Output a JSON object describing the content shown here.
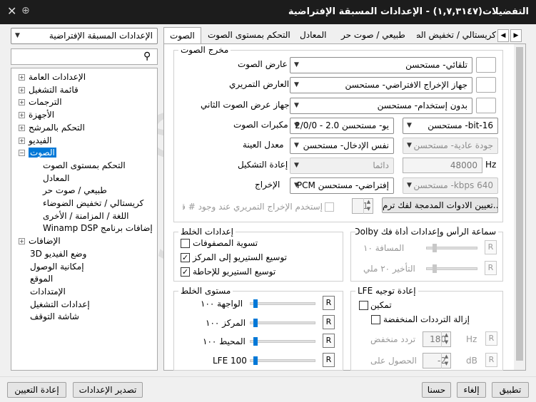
{
  "window": {
    "title": "التفضيلات(١,٧,٣١٤٧) - الإعدادات المسبقة الإفتراضية"
  },
  "preset": {
    "value": "الإعدادات المسبقة الإفتراضية"
  },
  "search": {
    "placeholder": ""
  },
  "tree": [
    {
      "label": "الإعدادات العامة",
      "expander": "+"
    },
    {
      "label": "قائمة التشغيل",
      "expander": "+"
    },
    {
      "label": "الترجمات",
      "expander": "+"
    },
    {
      "label": "الأجهزة",
      "expander": "+"
    },
    {
      "label": "التحكم بالمرشح",
      "expander": "+"
    },
    {
      "label": "الفيديو",
      "expander": "+"
    },
    {
      "label": "الصوت",
      "expander": "−"
    },
    {
      "label": "التحكم بمستوى الصوت"
    },
    {
      "label": "المعادل"
    },
    {
      "label": "طبيعي / صوت حر"
    },
    {
      "label": "كريستالي / تخفيض الضوضاء"
    },
    {
      "label": "اللغة / المزامنة / الأخرى"
    },
    {
      "label": "إضافات برنامج Winamp DSP"
    },
    {
      "label": "الإضافات",
      "expander": "+"
    },
    {
      "label": "وضع الفيديو 3D"
    },
    {
      "label": "إمكانية الوصول"
    },
    {
      "label": "الموقع"
    },
    {
      "label": "الإمتدادات"
    },
    {
      "label": "إعدادات التشغيل"
    },
    {
      "label": "شاشة التوقف"
    }
  ],
  "tabs": [
    {
      "label": "الصوت"
    },
    {
      "label": "التحكم بمستوى الصوت"
    },
    {
      "label": "المعادل"
    },
    {
      "label": "طبيعي / صوت حر"
    },
    {
      "label": "كريستالي / تخفيض الضوضاء"
    }
  ],
  "audio_output": {
    "group_label": "مخرج الصوت",
    "renderer_label": "عارض الصوت",
    "renderer_value": "تلقائي- مستحسن",
    "preview_label": "العارض التمريري",
    "preview_value": "جهاز الإخراج الافتراضي- مستحسن",
    "secondary_label": "جهاز عرض الصوت الثاني",
    "secondary_value": "بدون إستخدام- مستحسن",
    "speakers_label": "مكبرات الصوت",
    "speakers_value": "يو- مستحسن 2.0 - 2/0/0",
    "bitdepth_value": "16-bit- مستحسن",
    "samplerate_label": "معدل العينة",
    "samplerate_value": "نفس الإدخال- مستحسن",
    "quality_value": "جودة عادية- مستحسن",
    "resample_label": "إعادة التشكيل",
    "resample_value": "دائما",
    "hz_value": "48000",
    "hz_unit": "Hz",
    "output_label": "الإخراج",
    "output_value": "إفتراضي- مستحسن PCM",
    "bitrate_value": "640 kbps- مستحسن",
    "bitstream_checkbox": "إستخدم الإخراج التمريري عند وجود # قا",
    "bitstream_value": "1",
    "codec_button": "تعيين الادوات المدمجة لفك ترم..."
  },
  "mixing": {
    "group_label": "إعدادات الخلط",
    "normalize": "تسوية المصفوفات",
    "normalize_checked": false,
    "center": "توسيع الستيريو إلى المركز",
    "center_checked": true,
    "surround": "توسيع الستيريو للإحاطة",
    "surround_checked": true
  },
  "dolby": {
    "group_label": "سماعة الرأس وإعدادات أداة فك Dolby ...",
    "distance": "المسافة ١٠",
    "delay": "التأخير ٢٠ ملي",
    "reset": "R"
  },
  "mix_level": {
    "group_label": "مستوى الخلط",
    "front": "الواجهة ١٠٠",
    "center": "المركز ١٠٠",
    "surround": "المحيط ١٠٠",
    "lfe": "LFE 100",
    "front_level": 1.0,
    "center_level": 1.0,
    "surround_level": 1.0,
    "lfe_level": 1.0,
    "reset": "R"
  },
  "lfe": {
    "group_label": "إعادة توجيه LFE",
    "enable": "تمكين",
    "enable_checked": false,
    "lowpass": "إزالة الترددات المنخفضة",
    "lowpass_checked": false,
    "freq_label": "تردد منخفض",
    "freq_value": "180",
    "freq_unit": "Hz",
    "gain_label": "الحصول على",
    "gain_value": "-2",
    "gain_unit": "dB",
    "reset": "R"
  },
  "footer": {
    "reset": "إعادة التعيين",
    "export": "تصدير الإعدادات",
    "ok": "حسنا",
    "cancel": "إلغاء",
    "apply": "تطبيق"
  },
  "watermark": {
    "line1": "Freemake",
    "line2": "bsua.org"
  }
}
